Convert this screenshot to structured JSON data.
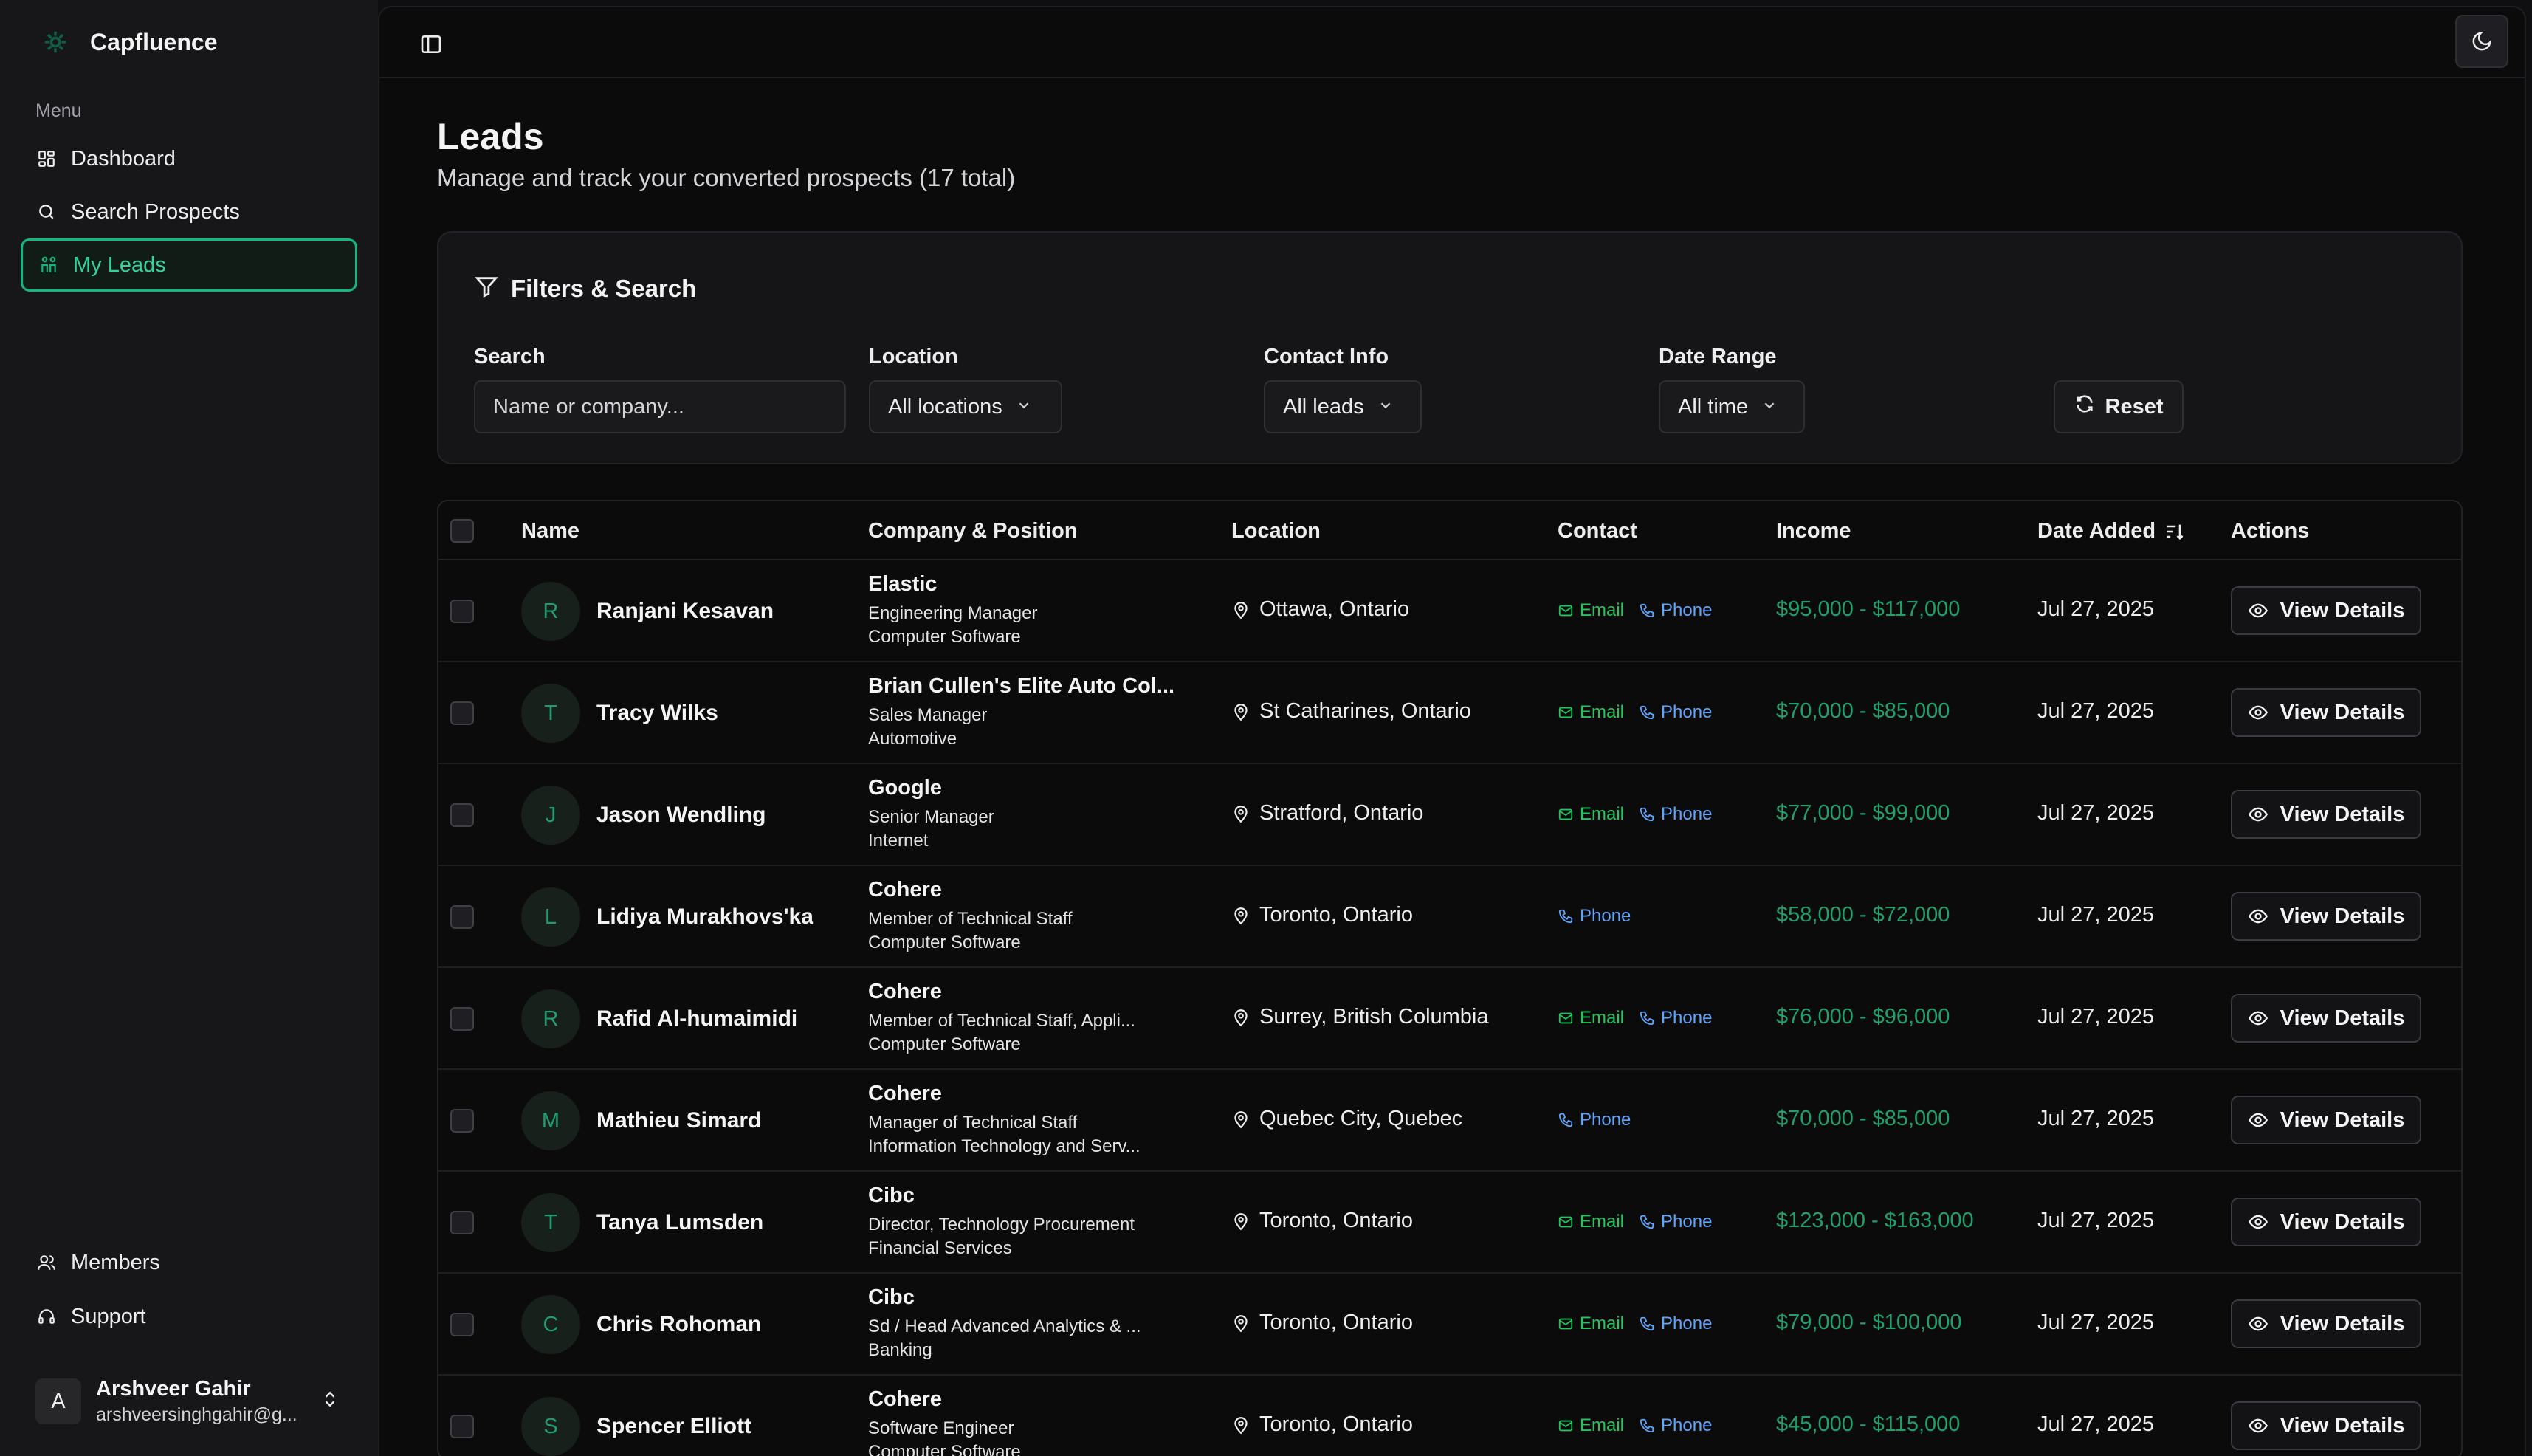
{
  "app": {
    "name": "Capfluence",
    "logo_icon": "leaf-icon"
  },
  "sidebar": {
    "menu_label": "Menu",
    "items": [
      {
        "label": "Dashboard",
        "icon": "dashboard-icon"
      },
      {
        "label": "Search Prospects",
        "icon": "search-icon"
      },
      {
        "label": "My Leads",
        "icon": "leads-icon",
        "active": true
      }
    ],
    "bottom_items": [
      {
        "label": "Members",
        "icon": "members-icon"
      },
      {
        "label": "Support",
        "icon": "headset-icon"
      }
    ],
    "user": {
      "initial": "A",
      "name": "Arshveer Gahir",
      "email": "arshveersinghgahir@g..."
    }
  },
  "header": {
    "title": "Leads",
    "subtitle": "Manage and track your converted prospects (17 total)"
  },
  "filters": {
    "title": "Filters & Search",
    "search": {
      "label": "Search",
      "placeholder": "Name or company..."
    },
    "location": {
      "label": "Location",
      "value": "All locations"
    },
    "contact": {
      "label": "Contact Info",
      "value": "All leads"
    },
    "date": {
      "label": "Date Range",
      "value": "All time"
    },
    "reset_label": "Reset"
  },
  "table": {
    "columns": [
      "Name",
      "Company & Position",
      "Location",
      "Contact",
      "Income",
      "Date Added",
      "Actions"
    ],
    "email_label": "Email",
    "phone_label": "Phone",
    "action_label": "View Details",
    "rows": [
      {
        "initial": "R",
        "name": "Ranjani Kesavan",
        "company": "Elastic",
        "position": "Engineering Manager",
        "industry": "Computer Software",
        "location": "Ottawa, Ontario",
        "email": true,
        "phone": true,
        "income": "$95,000 - $117,000",
        "date": "Jul 27, 2025"
      },
      {
        "initial": "T",
        "name": "Tracy Wilks",
        "company": "Brian Cullen's Elite Auto Col...",
        "position": "Sales Manager",
        "industry": "Automotive",
        "location": "St Catharines, Ontario",
        "email": true,
        "phone": true,
        "income": "$70,000 - $85,000",
        "date": "Jul 27, 2025"
      },
      {
        "initial": "J",
        "name": "Jason Wendling",
        "company": "Google",
        "position": "Senior Manager",
        "industry": "Internet",
        "location": "Stratford, Ontario",
        "email": true,
        "phone": true,
        "income": "$77,000 - $99,000",
        "date": "Jul 27, 2025"
      },
      {
        "initial": "L",
        "name": "Lidiya Murakhovs'ka",
        "company": "Cohere",
        "position": "Member of Technical Staff",
        "industry": "Computer Software",
        "location": "Toronto, Ontario",
        "email": false,
        "phone": true,
        "income": "$58,000 - $72,000",
        "date": "Jul 27, 2025"
      },
      {
        "initial": "R",
        "name": "Rafid Al-humaimidi",
        "company": "Cohere",
        "position": "Member of Technical Staff, Appli...",
        "industry": "Computer Software",
        "location": "Surrey, British Columbia",
        "email": true,
        "phone": true,
        "income": "$76,000 - $96,000",
        "date": "Jul 27, 2025"
      },
      {
        "initial": "M",
        "name": "Mathieu Simard",
        "company": "Cohere",
        "position": "Manager of Technical Staff",
        "industry": "Information Technology and Serv...",
        "location": "Quebec City, Quebec",
        "email": false,
        "phone": true,
        "income": "$70,000 - $85,000",
        "date": "Jul 27, 2025"
      },
      {
        "initial": "T",
        "name": "Tanya Lumsden",
        "company": "Cibc",
        "position": "Director, Technology Procurement",
        "industry": "Financial Services",
        "location": "Toronto, Ontario",
        "email": true,
        "phone": true,
        "income": "$123,000 - $163,000",
        "date": "Jul 27, 2025"
      },
      {
        "initial": "C",
        "name": "Chris Rohoman",
        "company": "Cibc",
        "position": "Sd / Head Advanced Analytics & ...",
        "industry": "Banking",
        "location": "Toronto, Ontario",
        "email": true,
        "phone": true,
        "income": "$79,000 - $100,000",
        "date": "Jul 27, 2025"
      },
      {
        "initial": "S",
        "name": "Spencer Elliott",
        "company": "Cohere",
        "position": "Software Engineer",
        "industry": "Computer Software",
        "location": "Toronto, Ontario",
        "email": true,
        "phone": true,
        "income": "$45,000 - $115,000",
        "date": "Jul 27, 2025"
      }
    ]
  },
  "colors": {
    "accent": "#10b981",
    "email": "#22c55e",
    "phone": "#60a5fa",
    "income": "#22a06b"
  }
}
